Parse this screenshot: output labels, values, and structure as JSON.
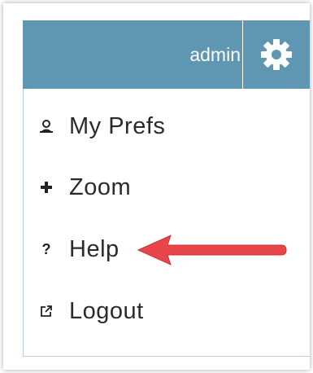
{
  "header": {
    "user_name": "admin",
    "settings_icon": "gear-icon",
    "background_color": "#5f97b2"
  },
  "menu": {
    "items": [
      {
        "label": "My Prefs",
        "icon": "user-icon"
      },
      {
        "label": "Zoom",
        "icon": "plus-icon"
      },
      {
        "label": "Help",
        "icon": "question-icon"
      },
      {
        "label": "Logout",
        "icon": "external-link-icon"
      }
    ]
  },
  "annotation": {
    "icon": "red-arrow-pointing-left",
    "color": "#e8464b"
  }
}
